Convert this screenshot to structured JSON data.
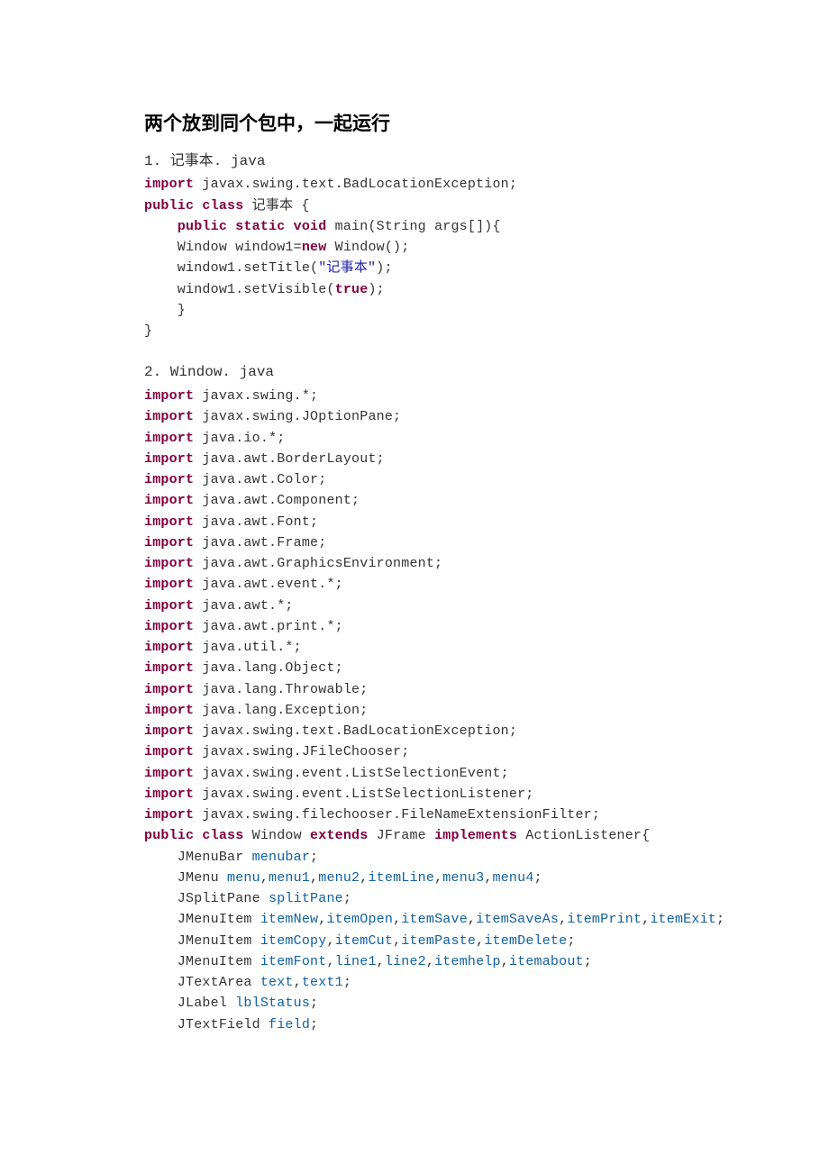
{
  "title": "两个放到同个包中，一起运行",
  "section1": {
    "heading": "1. 记事本. java",
    "lines": [
      [
        {
          "t": "import",
          "c": "kw"
        },
        {
          "t": " javax.swing.text.BadLocationException;"
        }
      ],
      [
        {
          "t": "public class",
          "c": "kw"
        },
        {
          "t": " 记事本 {"
        }
      ],
      [
        {
          "t": "    "
        },
        {
          "t": "public static void",
          "c": "kw"
        },
        {
          "t": " main(String args[]){"
        }
      ],
      [
        {
          "t": "    Window window1="
        },
        {
          "t": "new",
          "c": "kw"
        },
        {
          "t": " Window();"
        }
      ],
      [
        {
          "t": "    window1.setTitle("
        },
        {
          "t": "\"记事本\"",
          "c": "str"
        },
        {
          "t": ");"
        }
      ],
      [
        {
          "t": "    window1.setVisible("
        },
        {
          "t": "true",
          "c": "kw"
        },
        {
          "t": ");"
        }
      ],
      [
        {
          "t": "    }"
        }
      ],
      [
        {
          "t": "}"
        }
      ]
    ]
  },
  "section2": {
    "heading": "2.  Window. java",
    "lines": [
      [
        {
          "t": "import",
          "c": "kw"
        },
        {
          "t": " javax.swing.*;"
        }
      ],
      [
        {
          "t": "import",
          "c": "kw"
        },
        {
          "t": " javax.swing.JOptionPane;"
        }
      ],
      [
        {
          "t": "import",
          "c": "kw"
        },
        {
          "t": " java.io.*;"
        }
      ],
      [
        {
          "t": "import",
          "c": "kw"
        },
        {
          "t": " java.awt.BorderLayout;"
        }
      ],
      [
        {
          "t": "import",
          "c": "kw"
        },
        {
          "t": " java.awt.Color;"
        }
      ],
      [
        {
          "t": "import",
          "c": "kw"
        },
        {
          "t": " java.awt.Component;"
        }
      ],
      [
        {
          "t": "import",
          "c": "kw"
        },
        {
          "t": " java.awt.Font;"
        }
      ],
      [
        {
          "t": "import",
          "c": "kw"
        },
        {
          "t": " java.awt.Frame;"
        }
      ],
      [
        {
          "t": "import",
          "c": "kw"
        },
        {
          "t": " java.awt.GraphicsEnvironment;"
        }
      ],
      [
        {
          "t": "import",
          "c": "kw"
        },
        {
          "t": " java.awt.event.*;"
        }
      ],
      [
        {
          "t": "import",
          "c": "kw"
        },
        {
          "t": " java.awt.*;"
        }
      ],
      [
        {
          "t": "import",
          "c": "kw"
        },
        {
          "t": " java.awt.print.*;"
        }
      ],
      [
        {
          "t": "import",
          "c": "kw"
        },
        {
          "t": " java.util.*;"
        }
      ],
      [
        {
          "t": "import",
          "c": "kw"
        },
        {
          "t": " java.lang.Object;"
        }
      ],
      [
        {
          "t": "import",
          "c": "kw"
        },
        {
          "t": " java.lang.Throwable;"
        }
      ],
      [
        {
          "t": "import",
          "c": "kw"
        },
        {
          "t": " java.lang.Exception;"
        }
      ],
      [
        {
          "t": "import",
          "c": "kw"
        },
        {
          "t": " javax.swing.text.BadLocationException;"
        }
      ],
      [
        {
          "t": "import",
          "c": "kw"
        },
        {
          "t": " javax.swing.JFileChooser;"
        }
      ],
      [
        {
          "t": "import",
          "c": "kw"
        },
        {
          "t": " javax.swing.event.ListSelectionEvent;"
        }
      ],
      [
        {
          "t": "import",
          "c": "kw"
        },
        {
          "t": " javax.swing.event.ListSelectionListener;"
        }
      ],
      [
        {
          "t": "import",
          "c": "kw"
        },
        {
          "t": " javax.swing.filechooser.FileNameExtensionFilter;"
        }
      ],
      [
        {
          "t": "public class",
          "c": "kw"
        },
        {
          "t": " Window "
        },
        {
          "t": "extends",
          "c": "kw"
        },
        {
          "t": " JFrame "
        },
        {
          "t": "implements",
          "c": "kw"
        },
        {
          "t": " ActionListener{"
        }
      ],
      [
        {
          "t": "    JMenuBar "
        },
        {
          "t": "menubar",
          "c": "fld"
        },
        {
          "t": ";"
        }
      ],
      [
        {
          "t": "    JMenu "
        },
        {
          "t": "menu",
          "c": "fld"
        },
        {
          "t": ","
        },
        {
          "t": "menu1",
          "c": "fld"
        },
        {
          "t": ","
        },
        {
          "t": "menu2",
          "c": "fld"
        },
        {
          "t": ","
        },
        {
          "t": "itemLine",
          "c": "fld"
        },
        {
          "t": ","
        },
        {
          "t": "menu3",
          "c": "fld"
        },
        {
          "t": ","
        },
        {
          "t": "menu4",
          "c": "fld"
        },
        {
          "t": ";"
        }
      ],
      [
        {
          "t": "    JSplitPane "
        },
        {
          "t": "splitPane",
          "c": "fld"
        },
        {
          "t": ";"
        }
      ],
      [
        {
          "t": "    JMenuItem "
        },
        {
          "t": "itemNew",
          "c": "fld"
        },
        {
          "t": ","
        },
        {
          "t": "itemOpen",
          "c": "fld"
        },
        {
          "t": ","
        },
        {
          "t": "itemSave",
          "c": "fld"
        },
        {
          "t": ","
        },
        {
          "t": "itemSaveAs",
          "c": "fld"
        },
        {
          "t": ","
        },
        {
          "t": "itemPrint",
          "c": "fld"
        },
        {
          "t": ","
        },
        {
          "t": "itemExit",
          "c": "fld"
        },
        {
          "t": ";"
        }
      ],
      [
        {
          "t": "    JMenuItem "
        },
        {
          "t": "itemCopy",
          "c": "fld"
        },
        {
          "t": ","
        },
        {
          "t": "itemCut",
          "c": "fld"
        },
        {
          "t": ","
        },
        {
          "t": "itemPaste",
          "c": "fld"
        },
        {
          "t": ","
        },
        {
          "t": "itemDelete",
          "c": "fld"
        },
        {
          "t": ";"
        }
      ],
      [
        {
          "t": "    JMenuItem "
        },
        {
          "t": "itemFont",
          "c": "fld"
        },
        {
          "t": ","
        },
        {
          "t": "line1",
          "c": "fld"
        },
        {
          "t": ","
        },
        {
          "t": "line2",
          "c": "fld"
        },
        {
          "t": ","
        },
        {
          "t": "itemhelp",
          "c": "fld"
        },
        {
          "t": ","
        },
        {
          "t": "itemabout",
          "c": "fld"
        },
        {
          "t": ";"
        }
      ],
      [
        {
          "t": "    JTextArea "
        },
        {
          "t": "text",
          "c": "fld"
        },
        {
          "t": ","
        },
        {
          "t": "text1",
          "c": "fld"
        },
        {
          "t": ";"
        }
      ],
      [
        {
          "t": "    JLabel "
        },
        {
          "t": "lblStatus",
          "c": "fld"
        },
        {
          "t": ";"
        }
      ],
      [
        {
          "t": "    JTextField "
        },
        {
          "t": "field",
          "c": "fld"
        },
        {
          "t": ";"
        }
      ]
    ]
  }
}
